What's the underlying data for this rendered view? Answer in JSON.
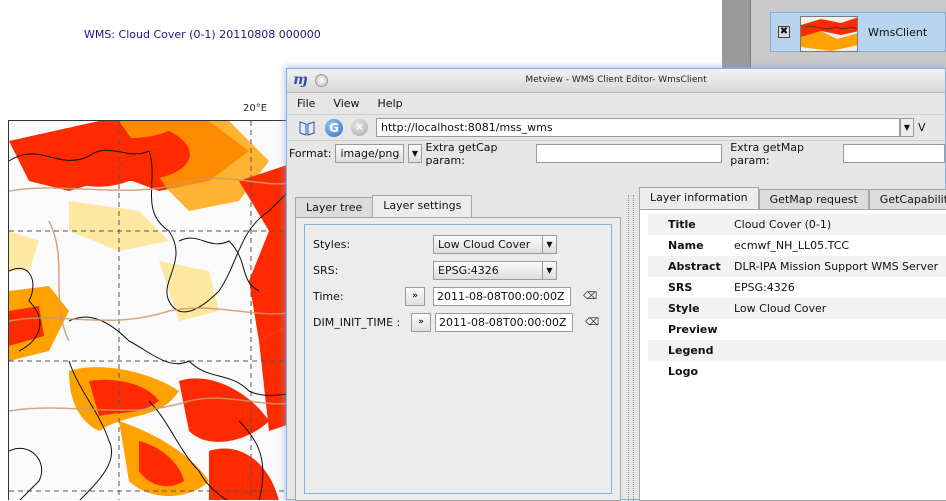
{
  "map": {
    "title": "WMS: Cloud Cover (0-1) 20110808 000000",
    "lon_label": "20°E"
  },
  "taskbar": {
    "close_glyph": "✖",
    "item_label": "WmsClient"
  },
  "editor": {
    "window_title": "Metview - WMS Client Editor- WmsClient",
    "app_logo": "ɱ",
    "menu": [
      "File",
      "View",
      "Help"
    ],
    "url": "http://localhost:8081/mss_wms",
    "url_extra": "V",
    "format_label": "Format:",
    "format_value": "image/png",
    "extra_getcap_label": "Extra getCap param:",
    "extra_getmap_label": "Extra getMap param:"
  },
  "left_tabs": [
    "Layer tree",
    "Layer settings"
  ],
  "settings": {
    "styles_label": "Styles:",
    "styles_value": "Low Cloud Cover",
    "srs_label": "SRS:",
    "srs_value": "EPSG:4326",
    "time_label": "Time:",
    "time_value": "2011-08-08T00:00:00Z",
    "dim_label": "DIM_INIT_TIME :",
    "dim_value": "2011-08-08T00:00:00Z",
    "nav_glyph": "»"
  },
  "right_tabs": [
    "Layer information",
    "GetMap request",
    "GetCapabilitie"
  ],
  "layer_info": [
    {
      "key": "Title",
      "value": "Cloud Cover (0-1)"
    },
    {
      "key": "Name",
      "value": "ecmwf_NH_LL05.TCC"
    },
    {
      "key": "Abstract",
      "value": "DLR-IPA Mission Support WMS Server"
    },
    {
      "key": "SRS",
      "value": "EPSG:4326"
    },
    {
      "key": "Style",
      "value": "Low Cloud Cover"
    },
    {
      "key": "Preview",
      "value": ""
    },
    {
      "key": "Legend",
      "value": ""
    },
    {
      "key": "Logo",
      "value": ""
    }
  ],
  "colors": {
    "cloud_high": "#ff2a00",
    "cloud_mid": "#ffa200",
    "cloud_low": "#ffe28a",
    "window_glow": "#8ab0d8"
  }
}
